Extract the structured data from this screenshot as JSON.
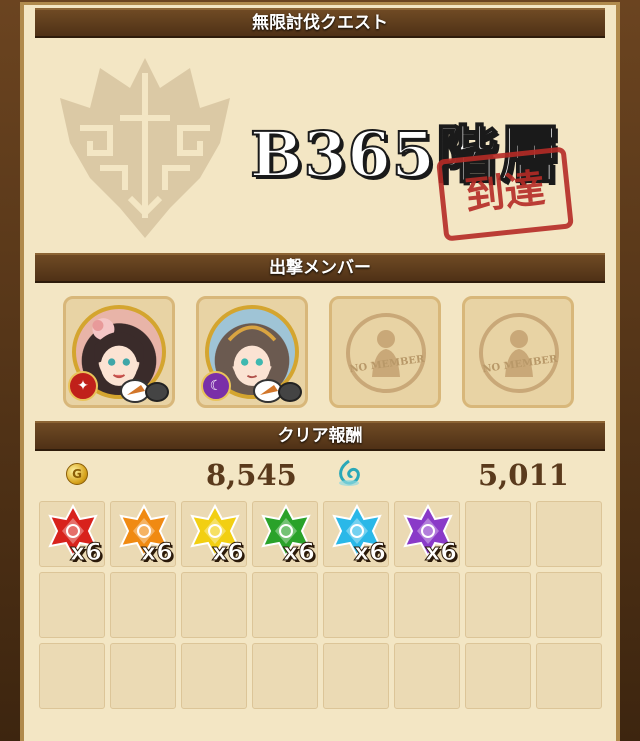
{
  "quest": {
    "title": "無限討伐クエスト",
    "floor_text": "B365階層",
    "reached_stamp": "到達"
  },
  "members": {
    "header": "出撃メンバー",
    "slots": [
      {
        "type": "character",
        "element_icon": "fire-element-icon",
        "element_color": "#c0201a"
      },
      {
        "type": "character",
        "element_icon": "dark-element-icon",
        "element_color": "#7a2fa8"
      },
      {
        "type": "empty",
        "label": "NO MEMBER"
      },
      {
        "type": "empty",
        "label": "NO MEMBER"
      }
    ]
  },
  "rewards": {
    "header": "クリア報酬",
    "gold_amount": "8,545",
    "soul_amount": "5,011",
    "items": [
      {
        "gem": "red-gem-icon",
        "color": "#d8221c",
        "qty": "x6"
      },
      {
        "gem": "orange-gem-icon",
        "color": "#f08a12",
        "qty": "x6"
      },
      {
        "gem": "yellow-gem-icon",
        "color": "#f2cf12",
        "qty": "x6"
      },
      {
        "gem": "green-gem-icon",
        "color": "#2aa22a",
        "qty": "x6"
      },
      {
        "gem": "cyan-gem-icon",
        "color": "#2ab8e8",
        "qty": "x6"
      },
      {
        "gem": "purple-gem-icon",
        "color": "#8a3ac8",
        "qty": "x6"
      }
    ]
  },
  "colors": {
    "panel_bg": "#f3e6c4",
    "bar_bg": "#5e3c1c",
    "stamp_red": "#b52b26",
    "text_brown": "#5a3a1c"
  }
}
